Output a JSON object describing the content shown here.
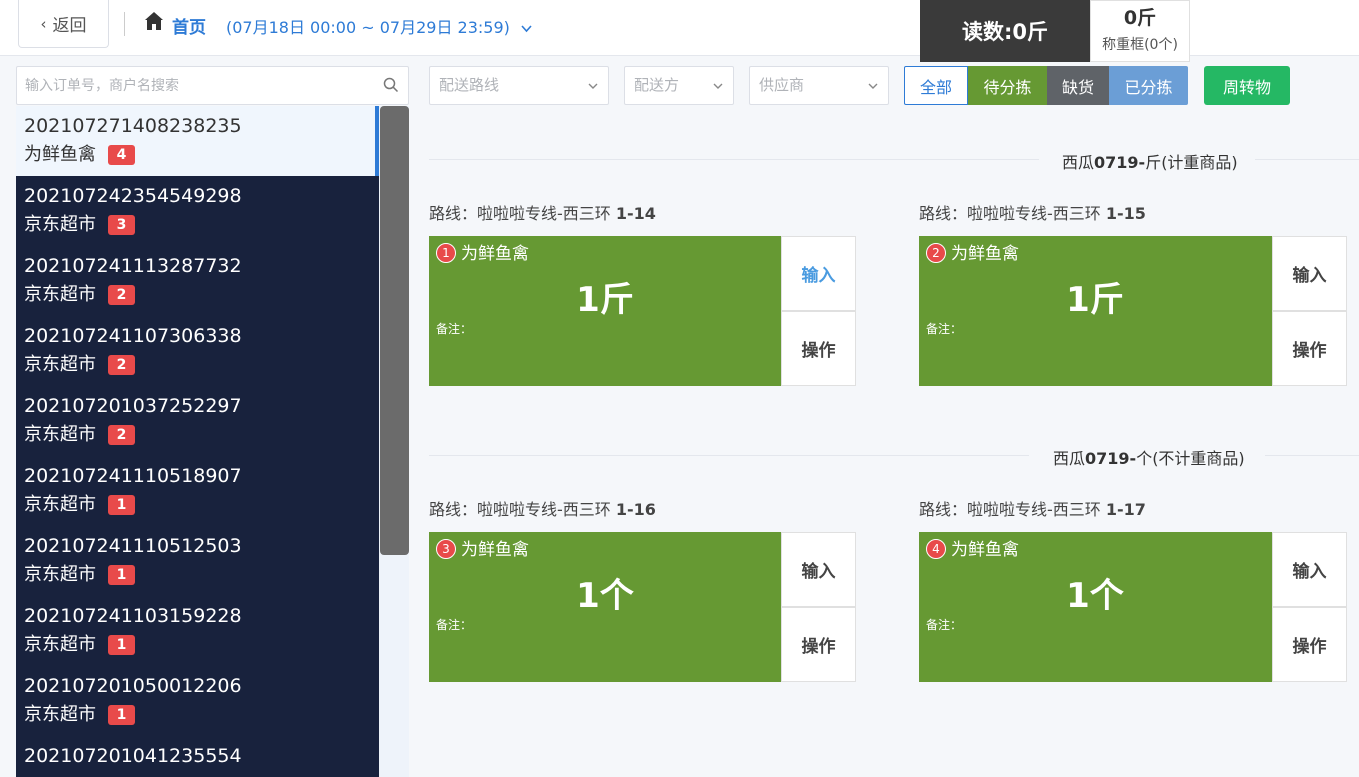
{
  "header": {
    "back_label": "返回",
    "home_label": "首页",
    "date_range": "(07月18日 00:00 ~ 07月29日 23:59)",
    "reading": "读数:0斤",
    "crate_weight": "0斤",
    "crate_label": "称重框(0个)"
  },
  "search": {
    "placeholder": "输入订单号，商户名搜索"
  },
  "orders": [
    {
      "order_no": "202107271408238235",
      "merchant": "为鲜鱼禽",
      "count": "4"
    },
    {
      "order_no": "202107242354549298",
      "merchant": "京东超市",
      "count": "3"
    },
    {
      "order_no": "202107241113287732",
      "merchant": "京东超市",
      "count": "2"
    },
    {
      "order_no": "202107241107306338",
      "merchant": "京东超市",
      "count": "2"
    },
    {
      "order_no": "202107201037252297",
      "merchant": "京东超市",
      "count": "2"
    },
    {
      "order_no": "202107241110518907",
      "merchant": "京东超市",
      "count": "1"
    },
    {
      "order_no": "202107241110512503",
      "merchant": "京东超市",
      "count": "1"
    },
    {
      "order_no": "202107241103159228",
      "merchant": "京东超市",
      "count": "1"
    },
    {
      "order_no": "202107201050012206",
      "merchant": "京东超市",
      "count": "1"
    },
    {
      "order_no": "202107201041235554",
      "merchant": "",
      "count": ""
    }
  ],
  "filters": {
    "route_placeholder": "配送路线",
    "distributor_placeholder": "配送方",
    "supplier_placeholder": "供应商",
    "tabs": [
      "全部",
      "待分拣",
      "缺货",
      "已分拣"
    ],
    "active_tab": "全部",
    "turnover_label": "周转物"
  },
  "sections": [
    {
      "title_pre": "西瓜",
      "title_bold": "0719-",
      "title_post": "斤(计重商品)",
      "cards": [
        {
          "route_pre": "路线：啦啦啦专线-西三环 ",
          "route_bold": "1-14",
          "index": "1",
          "merchant": "为鲜鱼禽",
          "qty": "1斤",
          "note": "备注：",
          "input_label": "输入",
          "op_label": "操作"
        },
        {
          "route_pre": "路线：啦啦啦专线-西三环 ",
          "route_bold": "1-15",
          "index": "2",
          "merchant": "为鲜鱼禽",
          "qty": "1斤",
          "note": "备注：",
          "input_label": "输入",
          "op_label": "操作"
        }
      ]
    },
    {
      "title_pre": "西瓜",
      "title_bold": "0719-",
      "title_post": "个(不计重商品)",
      "cards": [
        {
          "route_pre": "路线：啦啦啦专线-西三环 ",
          "route_bold": "1-16",
          "index": "3",
          "merchant": "为鲜鱼禽",
          "qty": "1个",
          "note": "备注：",
          "input_label": "输入",
          "op_label": "操作"
        },
        {
          "route_pre": "路线：啦啦啦专线-西三环 ",
          "route_bold": "1-17",
          "index": "4",
          "merchant": "为鲜鱼禽",
          "qty": "1个",
          "note": "备注：",
          "input_label": "输入",
          "op_label": "操作"
        }
      ]
    }
  ],
  "colors": {
    "accent_blue": "#2e7bd6",
    "card_green": "#669933",
    "sidebar_navy": "#18223d",
    "badge_red": "#e84a4a",
    "turnover_green": "#25b864"
  }
}
